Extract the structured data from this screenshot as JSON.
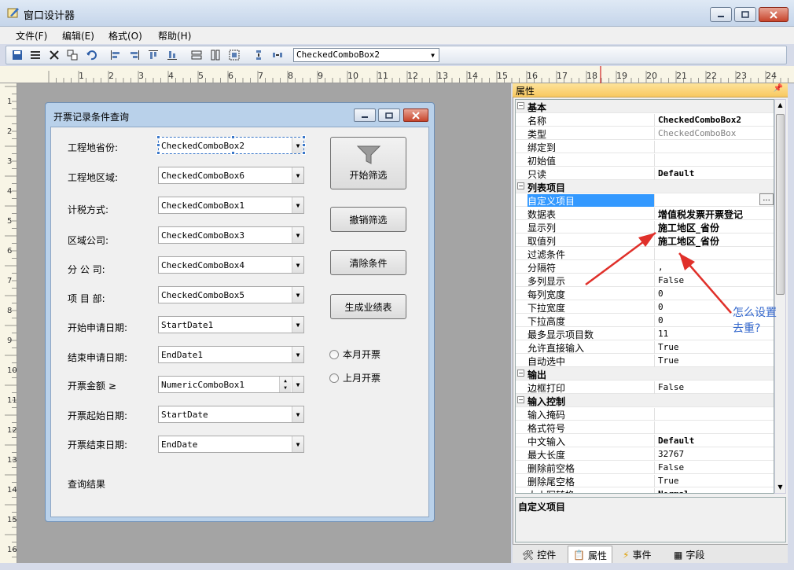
{
  "window": {
    "title": "窗口设计器"
  },
  "menu": [
    "文件(F)",
    "编辑(E)",
    "格式(O)",
    "帮助(H)"
  ],
  "toolbar": {
    "object_select": "CheckedComboBox2"
  },
  "ruler": {
    "top": [
      "1",
      "2",
      "3",
      "4",
      "5",
      "6",
      "7",
      "8",
      "9",
      "10",
      "11",
      "12",
      "13",
      "14",
      "15",
      "16",
      "17",
      "18",
      "19",
      "20",
      "21",
      "22",
      "23",
      "24"
    ],
    "left": [
      "1",
      "2",
      "3",
      "4",
      "5",
      "6",
      "7",
      "8",
      "9",
      "10",
      "11",
      "12",
      "13",
      "14",
      "15",
      "16"
    ]
  },
  "form": {
    "title": "开票记录条件查询",
    "fields": [
      {
        "label": "工程地省份:",
        "value": "CheckedComboBox2"
      },
      {
        "label": "工程地区域:",
        "value": "CheckedComboBox6"
      },
      {
        "label": "计税方式:",
        "value": "CheckedComboBox1"
      },
      {
        "label": "区域公司:",
        "value": "CheckedComboBox3"
      },
      {
        "label": "分 公 司:",
        "value": "CheckedComboBox4"
      },
      {
        "label": "项 目 部:",
        "value": "CheckedComboBox5"
      },
      {
        "label": "开始申请日期:",
        "value": "StartDate1"
      },
      {
        "label": "结束申请日期:",
        "value": "EndDate1"
      },
      {
        "label": "开票金额 ≥",
        "value": "NumericComboBox1"
      },
      {
        "label": "开票起始日期:",
        "value": "StartDate"
      },
      {
        "label": "开票结束日期:",
        "value": "EndDate"
      }
    ],
    "buttons": [
      "开始筛选",
      "撤销筛选",
      "清除条件",
      "生成业绩表"
    ],
    "radios": [
      "本月开票",
      "上月开票"
    ],
    "result_label": "查询结果"
  },
  "props": {
    "header": "属性",
    "rows": [
      {
        "cat": true,
        "name": "基本"
      },
      {
        "name": "名称",
        "value": "CheckedComboBox2",
        "bold": true
      },
      {
        "name": "类型",
        "value": "CheckedComboBox",
        "gray": true
      },
      {
        "name": "绑定到",
        "value": ""
      },
      {
        "name": "初始值",
        "value": ""
      },
      {
        "name": "只读",
        "value": "Default",
        "bold": true
      },
      {
        "cat": true,
        "name": "列表项目"
      },
      {
        "name": "自定义项目",
        "value": "",
        "selected": true
      },
      {
        "name": "数据表",
        "value": "增值税发票开票登记",
        "bold": true
      },
      {
        "name": "显示列",
        "value": "施工地区_省份",
        "bold": true
      },
      {
        "name": "取值列",
        "value": "施工地区_省份",
        "bold": true
      },
      {
        "name": "过滤条件",
        "value": ""
      },
      {
        "name": "分隔符",
        "value": ","
      },
      {
        "name": "多列显示",
        "value": "False"
      },
      {
        "name": "每列宽度",
        "value": "0"
      },
      {
        "name": "下拉宽度",
        "value": "0"
      },
      {
        "name": "下拉高度",
        "value": "0"
      },
      {
        "name": "最多显示项目数",
        "value": "11"
      },
      {
        "name": "允许直接输入",
        "value": "True"
      },
      {
        "name": "自动选中",
        "value": "True"
      },
      {
        "cat": true,
        "name": "输出"
      },
      {
        "name": "边框打印",
        "value": "False"
      },
      {
        "cat": true,
        "name": "输入控制"
      },
      {
        "name": "输入掩码",
        "value": ""
      },
      {
        "name": "格式符号",
        "value": ""
      },
      {
        "name": "中文输入",
        "value": "Default",
        "bold": true
      },
      {
        "name": "最大长度",
        "value": "32767"
      },
      {
        "name": "删除前空格",
        "value": "False"
      },
      {
        "name": "删除尾空格",
        "value": "True"
      },
      {
        "name": "大小写转换",
        "value": "Normal",
        "bold": true
      }
    ],
    "description": "自定义项目",
    "tabs": [
      "控件",
      "属性",
      "事件",
      "字段"
    ]
  },
  "annotation": {
    "line1": "怎么设置",
    "line2": "去重?"
  },
  "colors": {
    "accent": "#3399ff",
    "arrow": "#e0302a",
    "annotation": "#3266cc"
  }
}
